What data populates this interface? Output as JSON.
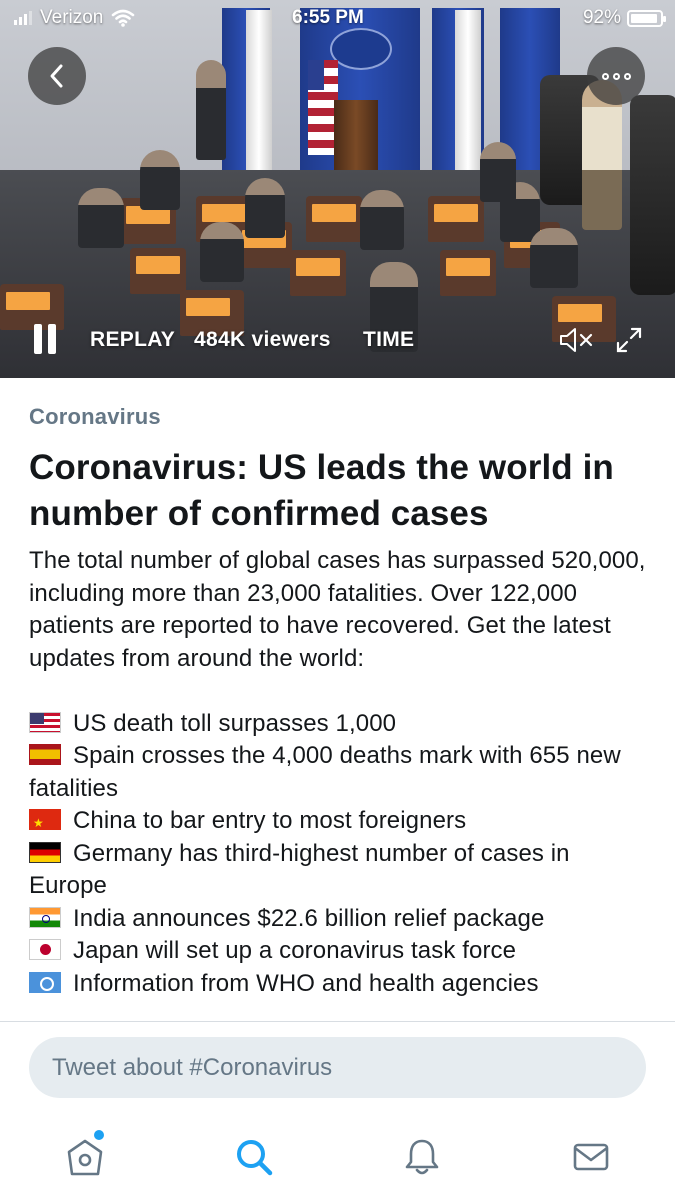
{
  "status_bar": {
    "carrier": "Verizon",
    "time": "6:55 PM",
    "battery": "92%",
    "battery_level": 0.92
  },
  "video": {
    "controls": {
      "replay_label": "REPLAY",
      "viewers": "484K viewers",
      "source": "TIME"
    },
    "icons": [
      "back-arrow-icon",
      "more-options-icon",
      "pause-icon",
      "mute-icon",
      "fullscreen-icon"
    ]
  },
  "article": {
    "category": "Coronavirus",
    "headline": "Coronavirus: US leads the world in number of confirmed cases",
    "summary": "The total number of global cases has surpassed 520,000, including more than 23,000 fatalities. Over 122,000 patients are reported to have recovered. Get the latest updates from around the world:",
    "bullets": [
      {
        "flag": "us-flag-icon",
        "text": "US death toll surpasses 1,000"
      },
      {
        "flag": "spain-flag-icon",
        "text": "Spain crosses the 4,000 deaths mark with 655 new fatalities"
      },
      {
        "flag": "china-flag-icon",
        "text": "China to bar entry to most foreigners"
      },
      {
        "flag": "germany-flag-icon",
        "text": "Germany has third-highest number of cases in Europe"
      },
      {
        "flag": "india-flag-icon",
        "text": "India announces $22.6 billion relief package"
      },
      {
        "flag": "japan-flag-icon",
        "text": "Japan will set up a coronavirus task force"
      },
      {
        "flag": "un-flag-icon",
        "text": "Information from WHO and health agencies"
      }
    ]
  },
  "compose": {
    "placeholder": "Tweet about #Coronavirus"
  },
  "tabbar": {
    "tabs": [
      "home-icon",
      "search-icon",
      "notifications-icon",
      "messages-icon"
    ],
    "active": "search-icon",
    "accent_color": "#1da1f2"
  }
}
